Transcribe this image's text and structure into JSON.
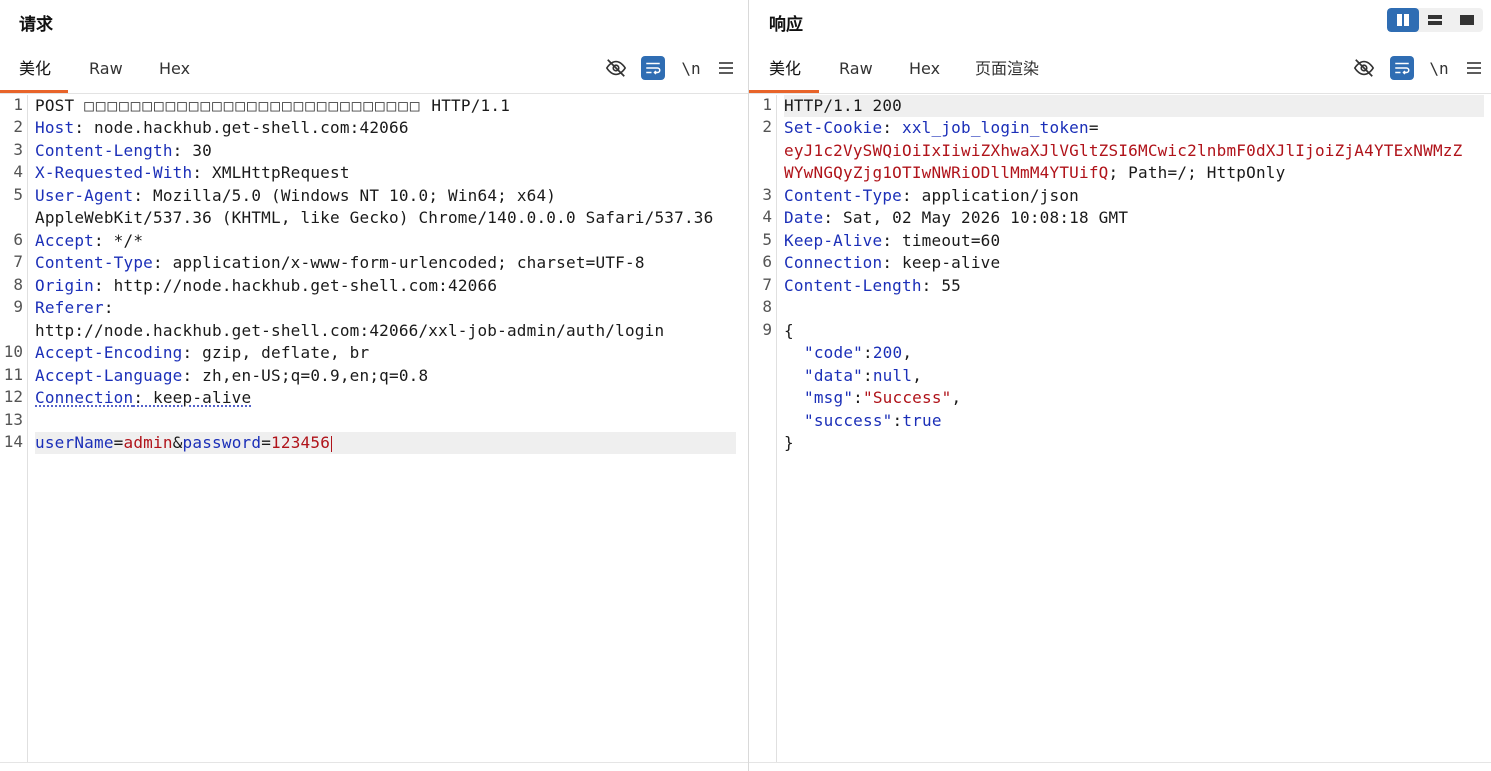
{
  "request": {
    "title": "请求",
    "tabs": [
      "美化",
      "Raw",
      "Hex"
    ],
    "active_tab": "美化",
    "toolbar": {
      "newline_label": "\\n"
    },
    "lines": [
      {
        "num": "1",
        "method": "POST",
        "path_glyphs": "□□□□□□□□□□□□□□□□□□□□□□□□□□□□□",
        "protocol": "HTTP/1.1"
      },
      {
        "num": "2",
        "key": "Host",
        "value": "node.hackhub.get-shell.com:42066"
      },
      {
        "num": "3",
        "key": "Content-Length",
        "value": "30"
      },
      {
        "num": "4",
        "key": "X-Requested-With",
        "value": "XMLHttpRequest"
      },
      {
        "num": "5",
        "key": "User-Agent",
        "value": "Mozilla/5.0 (Windows NT 10.0; Win64; x64)",
        "value_cont": "AppleWebKit/537.36 (KHTML, like Gecko) Chrome/140.0.0.0 Safari/537.36"
      },
      {
        "num": "6",
        "key": "Accept",
        "value": "*/*"
      },
      {
        "num": "7",
        "key": "Content-Type",
        "value": "application/x-www-form-urlencoded; charset=UTF-8"
      },
      {
        "num": "8",
        "key": "Origin",
        "value": "http://node.hackhub.get-shell.com:42066"
      },
      {
        "num": "9",
        "key": "Referer",
        "value": "",
        "value_cont": "http://node.hackhub.get-shell.com:42066/xxl-job-admin/auth/login"
      },
      {
        "num": "10",
        "key": "Accept-Encoding",
        "value": "gzip, deflate, br"
      },
      {
        "num": "11",
        "key": "Accept-Language",
        "value": "zh,en-US;q=0.9,en;q=0.8"
      },
      {
        "num": "12",
        "key": "Connection",
        "value": "keep-alive"
      },
      {
        "num": "13"
      },
      {
        "num": "14",
        "body": {
          "k1": "userName",
          "v1": "admin",
          "k2": "password",
          "v2": "123456"
        }
      }
    ]
  },
  "response": {
    "title": "响应",
    "tabs": [
      "美化",
      "Raw",
      "Hex",
      "页面渲染"
    ],
    "active_tab": "美化",
    "toolbar": {
      "newline_label": "\\n"
    },
    "lines": [
      {
        "num": "1",
        "status": "HTTP/1.1 200"
      },
      {
        "num": "2",
        "key": "Set-Cookie",
        "cookie_name": "xxl_job_login_token",
        "cookie_val_1": "eyJ1c2VySWQiOiIxIiwiZXhwaXJlVGltZSI6MCwic2lnbmF0dXJlIjoiZjA4YTExNWMzZ",
        "cookie_val_2": "WYwNGQyZjg1OTIwNWRiODllMmM4YTUifQ",
        "cookie_attrs": "; Path=/; HttpOnly"
      },
      {
        "num": "3",
        "key": "Content-Type",
        "value": "application/json"
      },
      {
        "num": "4",
        "key": "Date",
        "value": "Sat, 02 May 2026 10:08:18 GMT"
      },
      {
        "num": "5",
        "key": "Keep-Alive",
        "value": "timeout=60"
      },
      {
        "num": "6",
        "key": "Connection",
        "value": "keep-alive"
      },
      {
        "num": "7",
        "key": "Content-Length",
        "value": "55"
      },
      {
        "num": "8"
      },
      {
        "num": "9"
      }
    ],
    "json_body": {
      "open": "{",
      "code_key": "\"code\"",
      "code_val": "200",
      "data_key": "\"data\"",
      "data_val": "null",
      "msg_key": "\"msg\"",
      "msg_val": "\"Success\"",
      "success_key": "\"success\"",
      "success_val": "true",
      "close": "}"
    }
  },
  "colors": {
    "accent": "#e8642a",
    "button_blue": "#2f6db3",
    "key_blue": "#1b2fb8",
    "value_red": "#b0131a"
  }
}
